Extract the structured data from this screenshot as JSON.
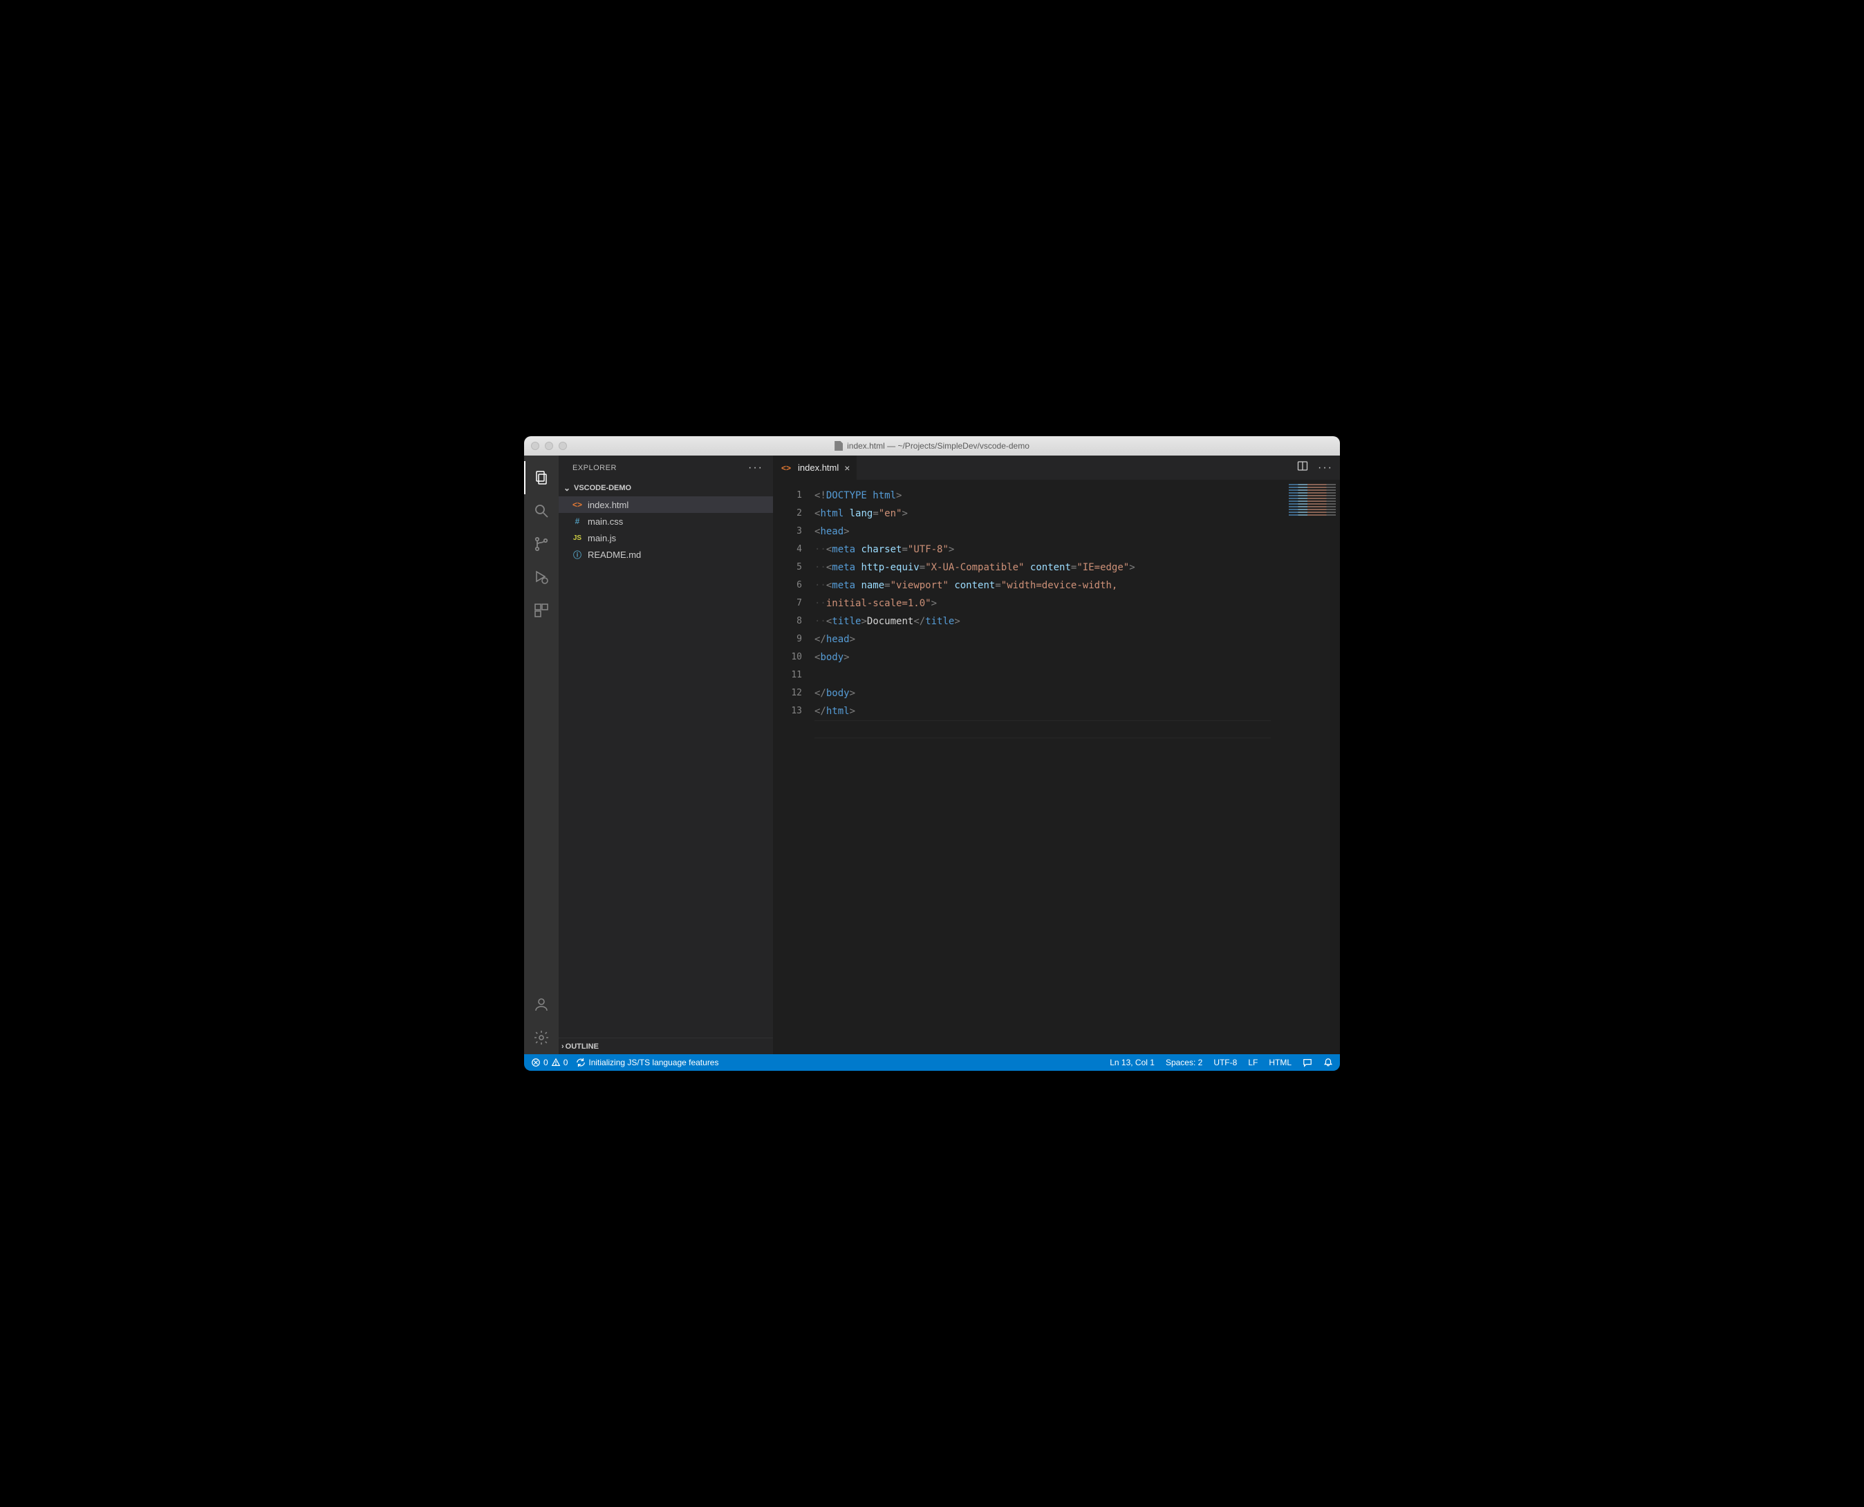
{
  "window": {
    "title": "index.html — ~/Projects/SimpleDev/vscode-demo"
  },
  "sidebar": {
    "title": "EXPLORER",
    "project": "VSCODE-DEMO",
    "files": [
      {
        "name": "index.html",
        "iconClass": "fi-html",
        "glyph": "<>",
        "active": true
      },
      {
        "name": "main.css",
        "iconClass": "fi-css",
        "glyph": "#",
        "active": false
      },
      {
        "name": "main.js",
        "iconClass": "fi-js",
        "glyph": "JS",
        "active": false
      },
      {
        "name": "README.md",
        "iconClass": "fi-md",
        "glyph": "ⓘ",
        "active": false
      }
    ],
    "outline": "OUTLINE"
  },
  "tabs": {
    "open": [
      {
        "label": "index.html",
        "iconClass": "fi-html",
        "glyph": "<>"
      }
    ]
  },
  "editor": {
    "linesCount": 13,
    "currentLine": 13,
    "code": [
      [
        {
          "c": "tok-punc",
          "t": "<!"
        },
        {
          "c": "tok-doctype",
          "t": "DOCTYPE "
        },
        {
          "c": "tok-tag",
          "t": "html"
        },
        {
          "c": "tok-punc",
          "t": ">"
        }
      ],
      [
        {
          "c": "tok-punc",
          "t": "<"
        },
        {
          "c": "tok-tag",
          "t": "html "
        },
        {
          "c": "tok-attr",
          "t": "lang"
        },
        {
          "c": "tok-punc",
          "t": "="
        },
        {
          "c": "tok-string",
          "t": "\"en\""
        },
        {
          "c": "tok-punc",
          "t": ">"
        }
      ],
      [
        {
          "c": "tok-punc",
          "t": "<"
        },
        {
          "c": "tok-tag",
          "t": "head"
        },
        {
          "c": "tok-punc",
          "t": ">"
        }
      ],
      [
        {
          "c": "tok-ws",
          "t": "··"
        },
        {
          "c": "tok-punc",
          "t": "<"
        },
        {
          "c": "tok-tag",
          "t": "meta "
        },
        {
          "c": "tok-attr",
          "t": "charset"
        },
        {
          "c": "tok-punc",
          "t": "="
        },
        {
          "c": "tok-string",
          "t": "\"UTF-8\""
        },
        {
          "c": "tok-punc",
          "t": ">"
        }
      ],
      [
        {
          "c": "tok-ws",
          "t": "··"
        },
        {
          "c": "tok-punc",
          "t": "<"
        },
        {
          "c": "tok-tag",
          "t": "meta "
        },
        {
          "c": "tok-attr",
          "t": "http-equiv"
        },
        {
          "c": "tok-punc",
          "t": "="
        },
        {
          "c": "tok-string",
          "t": "\"X-UA-Compatible\" "
        },
        {
          "c": "tok-attr",
          "t": "content"
        },
        {
          "c": "tok-punc",
          "t": "="
        },
        {
          "c": "tok-string",
          "t": "\"IE=edge\""
        },
        {
          "c": "tok-punc",
          "t": ">"
        }
      ],
      [
        {
          "c": "tok-ws",
          "t": "··"
        },
        {
          "c": "tok-punc",
          "t": "<"
        },
        {
          "c": "tok-tag",
          "t": "meta "
        },
        {
          "c": "tok-attr",
          "t": "name"
        },
        {
          "c": "tok-punc",
          "t": "="
        },
        {
          "c": "tok-string",
          "t": "\"viewport\" "
        },
        {
          "c": "tok-attr",
          "t": "content"
        },
        {
          "c": "tok-punc",
          "t": "="
        },
        {
          "c": "tok-string",
          "t": "\"width=device-width, "
        }
      ],
      [
        {
          "c": "tok-ws",
          "t": "··"
        },
        {
          "c": "tok-string",
          "t": "initial-scale=1.0\""
        },
        {
          "c": "tok-punc",
          "t": ">"
        }
      ],
      [
        {
          "c": "tok-ws",
          "t": "··"
        },
        {
          "c": "tok-punc",
          "t": "<"
        },
        {
          "c": "tok-tag",
          "t": "title"
        },
        {
          "c": "tok-punc",
          "t": ">"
        },
        {
          "c": "tok-text",
          "t": "Document"
        },
        {
          "c": "tok-punc",
          "t": "</"
        },
        {
          "c": "tok-tag",
          "t": "title"
        },
        {
          "c": "tok-punc",
          "t": ">"
        }
      ],
      [
        {
          "c": "tok-punc",
          "t": "</"
        },
        {
          "c": "tok-tag",
          "t": "head"
        },
        {
          "c": "tok-punc",
          "t": ">"
        }
      ],
      [
        {
          "c": "tok-punc",
          "t": "<"
        },
        {
          "c": "tok-tag",
          "t": "body"
        },
        {
          "c": "tok-punc",
          "t": ">"
        }
      ],
      [],
      [
        {
          "c": "tok-punc",
          "t": "</"
        },
        {
          "c": "tok-tag",
          "t": "body"
        },
        {
          "c": "tok-punc",
          "t": ">"
        }
      ],
      [
        {
          "c": "tok-punc",
          "t": "</"
        },
        {
          "c": "tok-tag",
          "t": "html"
        },
        {
          "c": "tok-punc",
          "t": ">"
        }
      ],
      []
    ],
    "lineNumberMap": [
      1,
      2,
      3,
      4,
      5,
      6,
      "",
      7,
      8,
      9,
      10,
      11,
      12,
      13
    ]
  },
  "statusbar": {
    "errors": "0",
    "warnings": "0",
    "syncText": "Initializing JS/TS language features",
    "lineCol": "Ln 13, Col 1",
    "spaces": "Spaces: 2",
    "encoding": "UTF-8",
    "eol": "LF",
    "language": "HTML"
  }
}
